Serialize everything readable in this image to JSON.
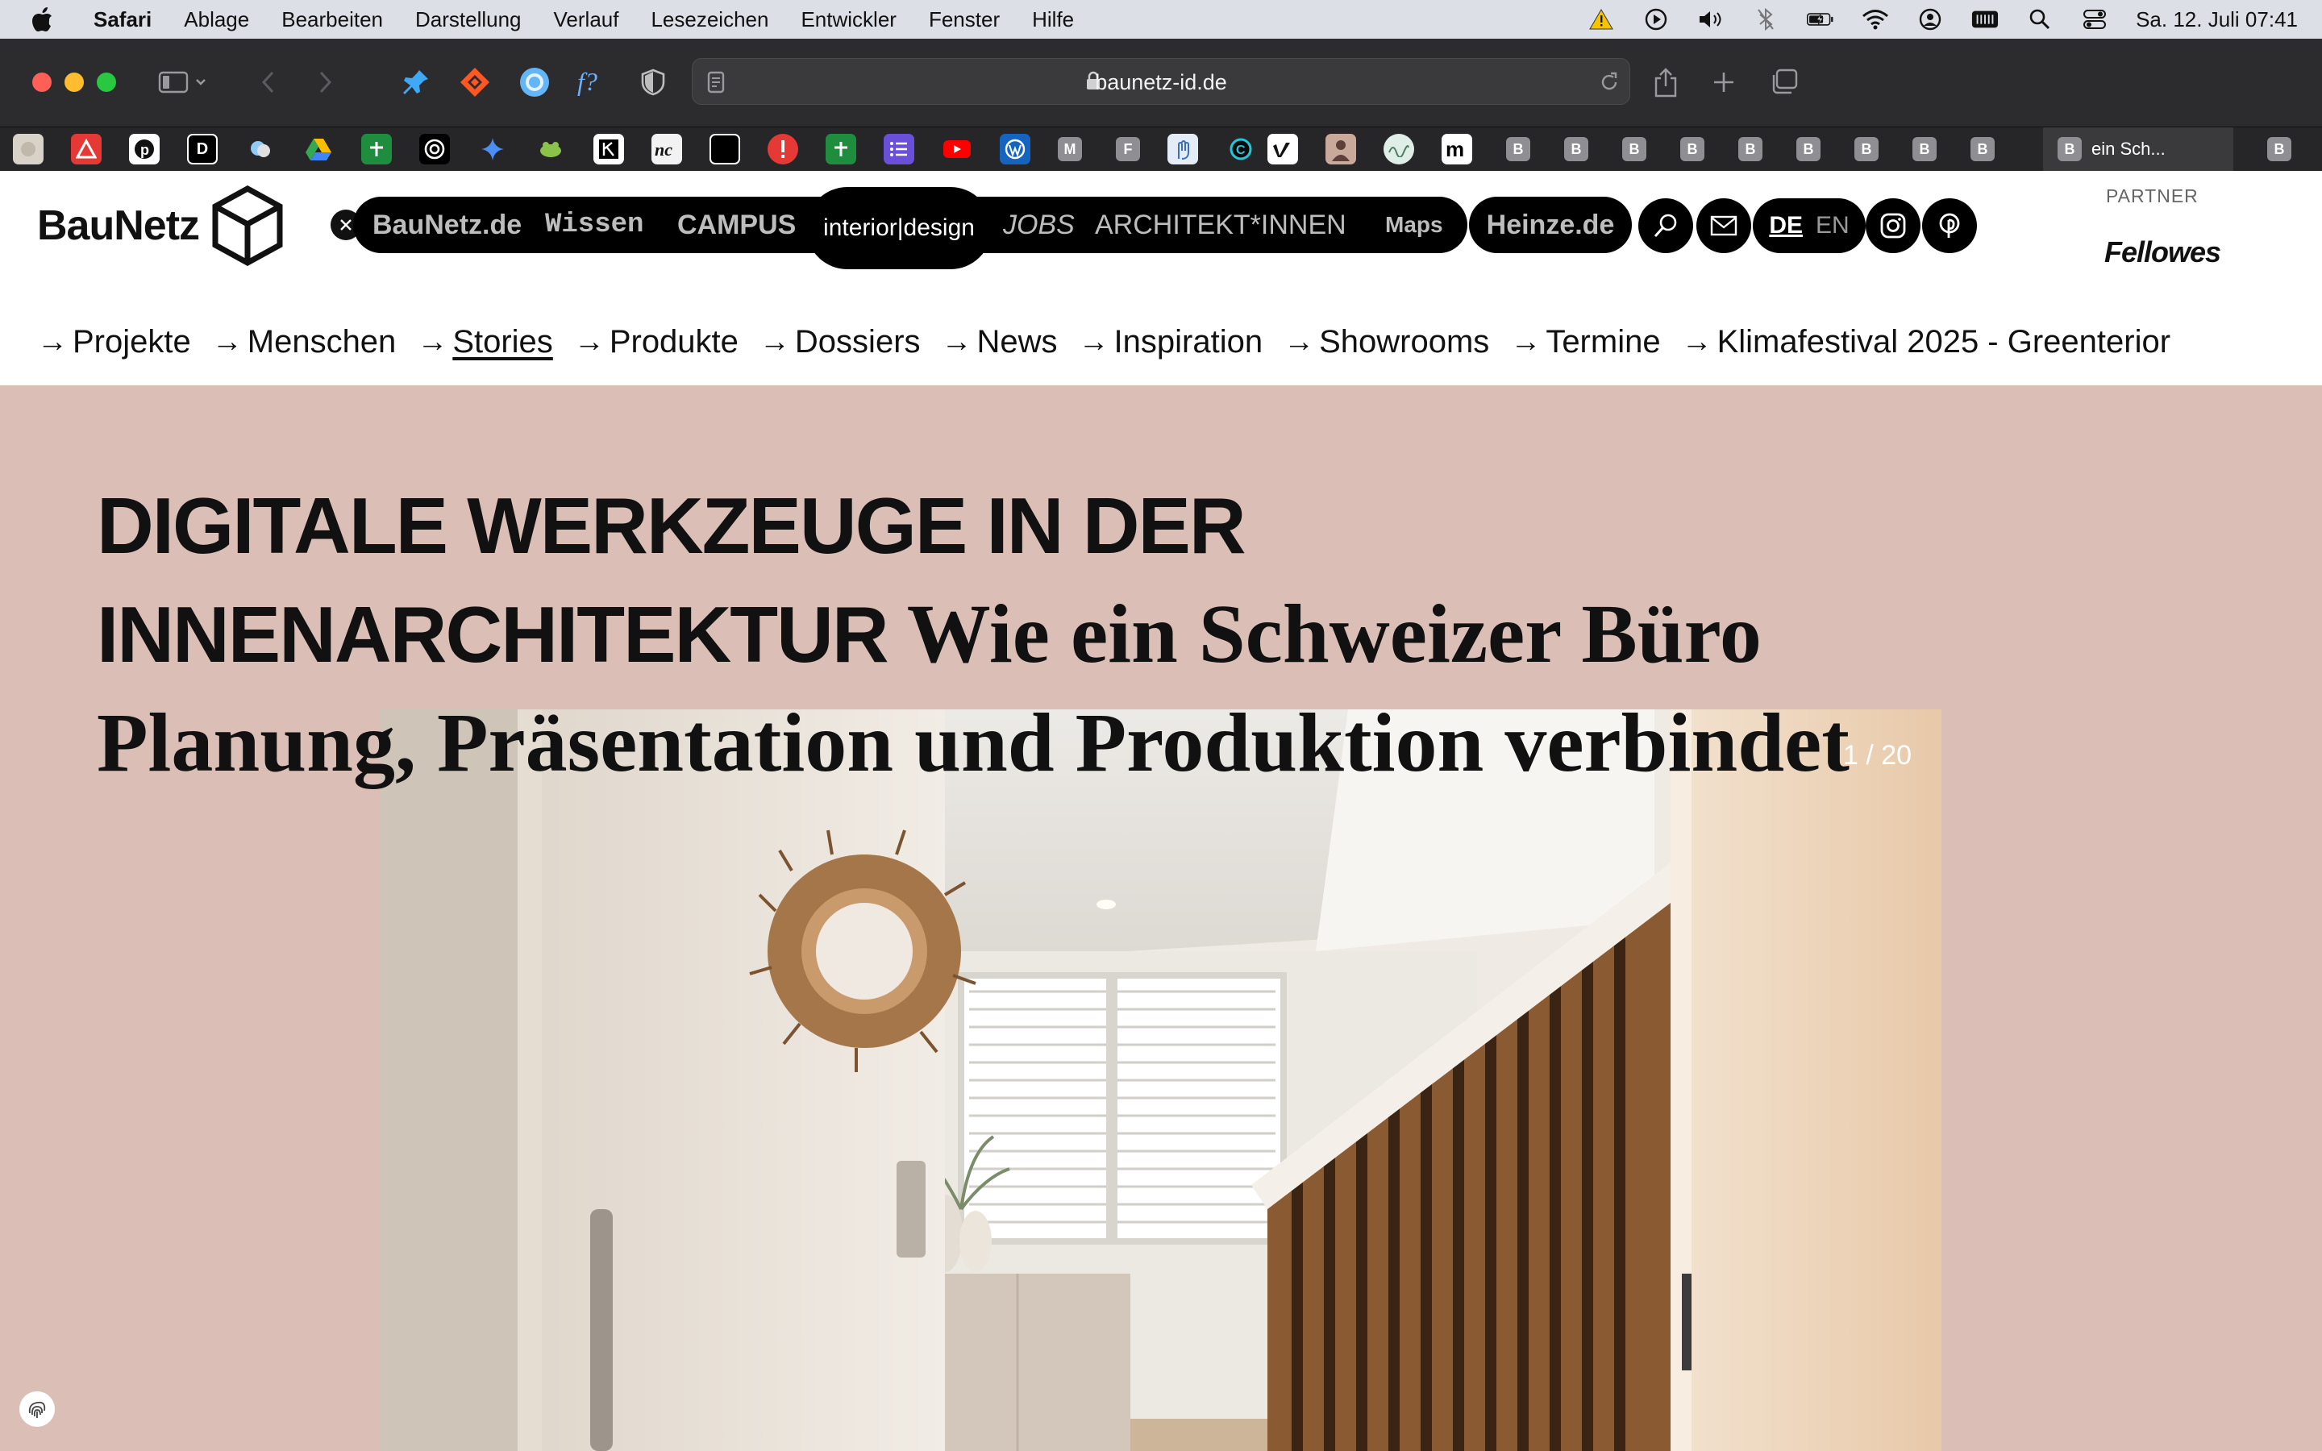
{
  "menubar": {
    "app": "Safari",
    "items": [
      "Ablage",
      "Bearbeiten",
      "Darstellung",
      "Verlauf",
      "Lesezeichen",
      "Entwickler",
      "Fenster",
      "Hilfe"
    ],
    "clock": "Sa. 12. Juli  07:41"
  },
  "toolbar": {
    "url": "baunetz-id.de"
  },
  "favbar": {
    "b_label": "B",
    "m_label": "M",
    "f_label": "F",
    "d_label": "D",
    "active_tab_title": "ein Sch..."
  },
  "header": {
    "logo": "BauNetz",
    "nav": {
      "baunetz": "BauNetz.de",
      "wissen": "Wissen",
      "campus": "CAMPUS",
      "interior": "interior|design",
      "jobs": "JOBS",
      "architekt": "ARCHITEKT*INNEN",
      "maps": "Maps",
      "heinze": "Heinze.de"
    },
    "lang_de": "DE",
    "lang_en": "EN",
    "partner_label": "PARTNER",
    "partner_name": "Fellowes"
  },
  "subnav": {
    "items": [
      "Projekte",
      "Menschen",
      "Stories",
      "Produkte",
      "Dossiers",
      "News",
      "Inspiration",
      "Showrooms",
      "Termine",
      "Klimafestival 2025 - Greenterior"
    ],
    "arrow": "→",
    "current": "Stories"
  },
  "article": {
    "title_line1": "DIGITALE WERKZEUGE IN DER",
    "title_line2": "INNENARCHITEKTUR",
    "subtitle_a": " Wie ein Schweizer Büro",
    "subtitle_b": "Planung, Präsentation und Produktion verbindet",
    "counter": "1 / 20"
  },
  "colors": {
    "page_bg": "#dbbfb7",
    "toolbar_bg": "#2c2c2e",
    "accent_black": "#000000"
  }
}
